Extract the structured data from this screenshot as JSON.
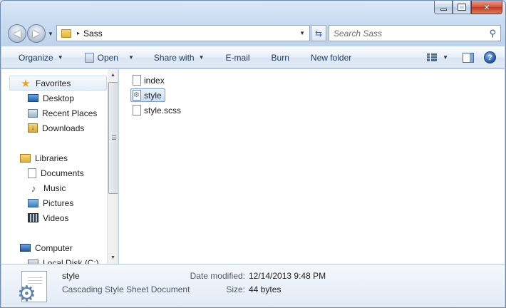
{
  "window": {
    "caption": {
      "close": "✕"
    }
  },
  "address": {
    "path": "Sass",
    "separator": "▸"
  },
  "search": {
    "placeholder": "Search Sass"
  },
  "toolbar": {
    "organize": "Organize",
    "open": "Open",
    "share_with": "Share with",
    "email": "E-mail",
    "burn": "Burn",
    "new_folder": "New folder",
    "help": "?"
  },
  "nav": {
    "favorites": "Favorites",
    "desktop": "Desktop",
    "recent_places": "Recent Places",
    "downloads": "Downloads",
    "libraries": "Libraries",
    "documents": "Documents",
    "music": "Music",
    "pictures": "Pictures",
    "videos": "Videos",
    "computer": "Computer",
    "local_disk": "Local Disk (C:)"
  },
  "files": [
    {
      "name": "index"
    },
    {
      "name": "style"
    },
    {
      "name": "style.scss"
    }
  ],
  "details": {
    "name": "style",
    "type": "Cascading Style Sheet Document",
    "date_modified_label": "Date modified:",
    "date_modified": "12/14/2013 9:48 PM",
    "size_label": "Size:",
    "size": "44 bytes"
  },
  "colors": {
    "selection_border": "#7da2ce",
    "toolbar_text": "#1e395b",
    "close_button": "#c23a1f"
  }
}
